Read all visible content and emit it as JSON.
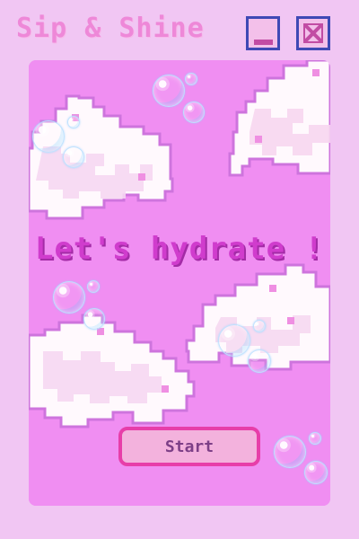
{
  "window": {
    "title": "Sip & Shine",
    "minimize_icon": "minimize-icon",
    "close_icon": "close-icon"
  },
  "screen": {
    "headline": "Let's hydrate !",
    "start_label": "Start"
  },
  "colors": {
    "frame": "#f1c6f3",
    "panel": "#f08ef2",
    "title": "#ee88d8",
    "window_button_border": "#3f49b5",
    "headline": "#d03ccd",
    "button_border": "#e73ea9",
    "button_fill": "#f3b2dd",
    "button_text": "#7d3f87"
  }
}
